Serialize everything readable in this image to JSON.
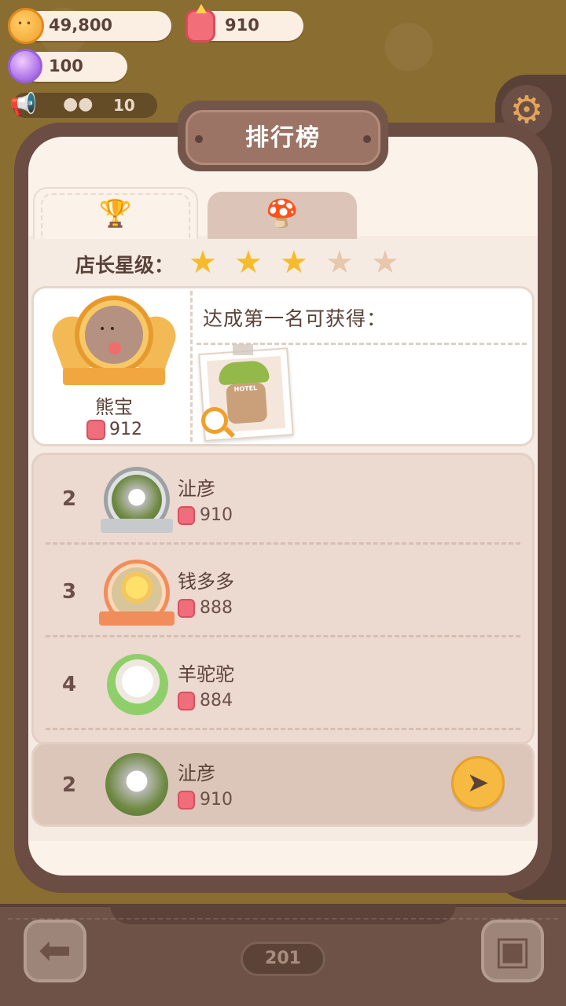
{
  "currencies": {
    "coins": "49,800",
    "hearts": "910",
    "gems": "100",
    "online": "10"
  },
  "panel": {
    "title": "排行榜"
  },
  "tabs": [
    {
      "icon": "trophy-icon",
      "active": true
    },
    {
      "icon": "world-icon",
      "active": false
    }
  ],
  "star_rating": {
    "label": "店长星级：",
    "filled": 3,
    "total": 5
  },
  "top_player": {
    "name": "熊宝",
    "score": "912",
    "reward_label": "达成第一名可获得：",
    "reward_sign": "HOTEL"
  },
  "ranking": [
    {
      "rank": "2",
      "name": "沚彦",
      "score": "910",
      "frame": "silver"
    },
    {
      "rank": "3",
      "name": "钱多多",
      "score": "888",
      "frame": "bronze"
    },
    {
      "rank": "4",
      "name": "羊驼驼",
      "score": "884",
      "frame": "none"
    }
  ],
  "self": {
    "rank": "2",
    "name": "沚彦",
    "score": "910"
  },
  "bottom": {
    "page": "201"
  },
  "colors": {
    "panel_border": "#6b4d43",
    "panel_bg": "#fbf2ea",
    "star_on": "#f6bb2d",
    "star_off": "#e7c7ad",
    "accent": "#f6b941",
    "score_icon": "#f06d7b"
  }
}
